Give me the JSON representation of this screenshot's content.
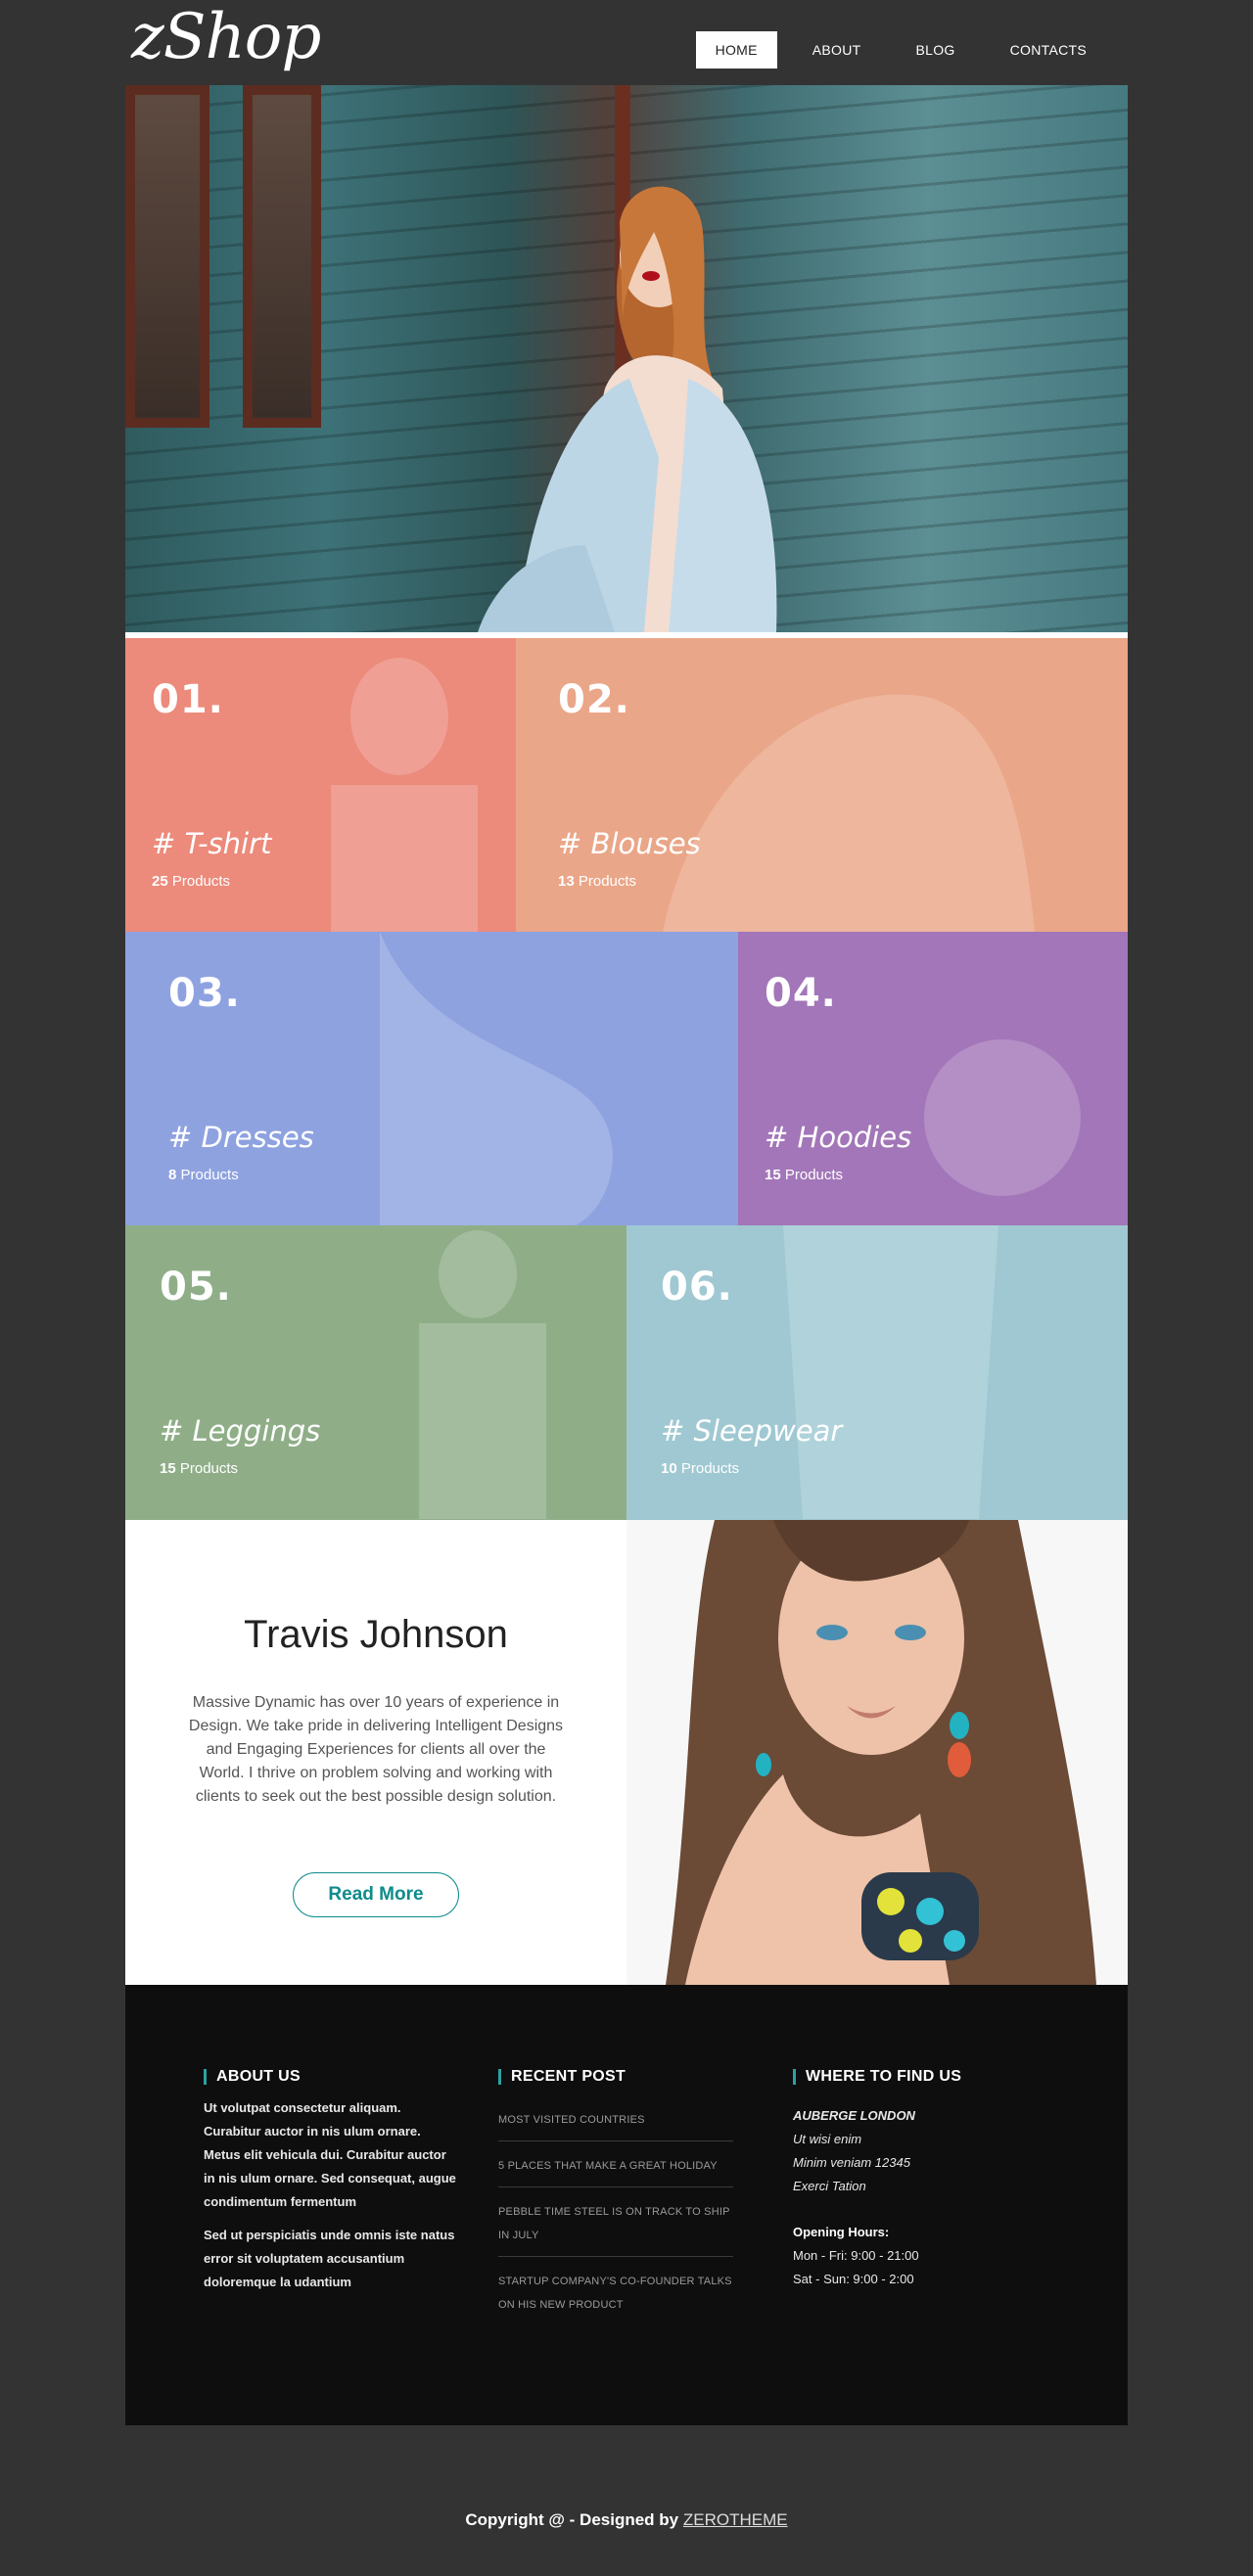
{
  "brand": {
    "logo": "zShop"
  },
  "nav": [
    {
      "label": "HOME",
      "active": true
    },
    {
      "label": "ABOUT",
      "active": false
    },
    {
      "label": "BLOG",
      "active": false
    },
    {
      "label": "CONTACTS",
      "active": false
    }
  ],
  "categories": [
    {
      "num": "01.",
      "title": "# T-shirt",
      "count": "25",
      "count_label": "Products",
      "color": "#ec8a7b"
    },
    {
      "num": "02.",
      "title": "# Blouses",
      "count": "13",
      "count_label": "Products",
      "color": "#eaa688"
    },
    {
      "num": "03.",
      "title": "# Dresses",
      "count": "8",
      "count_label": "Products",
      "color": "#8ea2e0"
    },
    {
      "num": "04.",
      "title": "# Hoodies",
      "count": "15",
      "count_label": "Products",
      "color": "#a276b8"
    },
    {
      "num": "05.",
      "title": "# Leggings",
      "count": "15",
      "count_label": "Products",
      "color": "#8fae88"
    },
    {
      "num": "06.",
      "title": "# Sleepwear",
      "count": "10",
      "count_label": "Products",
      "color": "#9fc8d2"
    }
  ],
  "about": {
    "name": "Travis Johnson",
    "description": "Massive Dynamic has over 10 years of experience in Design. We take pride in delivering Intelligent Designs and Engaging Experiences for clients all over the World. I thrive on problem solving and working with clients to seek out the best possible design solution.",
    "button": "Read More"
  },
  "footer": {
    "about_title": "ABOUT US",
    "about_p1": "Ut volutpat consectetur aliquam. Curabitur auctor in nis ulum ornare. Metus elit vehicula dui. Curabitur auctor in nis ulum ornare. Sed consequat, augue condimentum fermentum",
    "about_p2": "Sed ut perspiciatis unde omnis iste natus error sit voluptatem accusantium doloremque la udantium",
    "recent_title": "RECENT POST",
    "posts": [
      "MOST VISITED COUNTRIES",
      "5 PLACES THAT MAKE A GREAT HOLIDAY",
      "PEBBLE TIME STEEL IS ON TRACK TO SHIP IN JULY",
      "STARTUP COMPANY'S CO-FOUNDER TALKS ON HIS NEW PRODUCT"
    ],
    "find_title": "WHERE TO FIND US",
    "address": [
      "AUBERGE LONDON",
      "Ut wisi enim",
      "Minim veniam 12345",
      "Exerci Tation"
    ],
    "hours_title": "Opening Hours:",
    "hours": [
      "Mon - Fri: 9:00 - 21:00",
      "Sat - Sun: 9:00 - 2:00"
    ]
  },
  "copyright": {
    "text": "Copyright @ - Designed by",
    "link": "ZEROTHEME"
  },
  "colors": {
    "accent": "#0e8b8b",
    "footer_bg": "#0e0e0e",
    "page_bg": "#333333"
  }
}
